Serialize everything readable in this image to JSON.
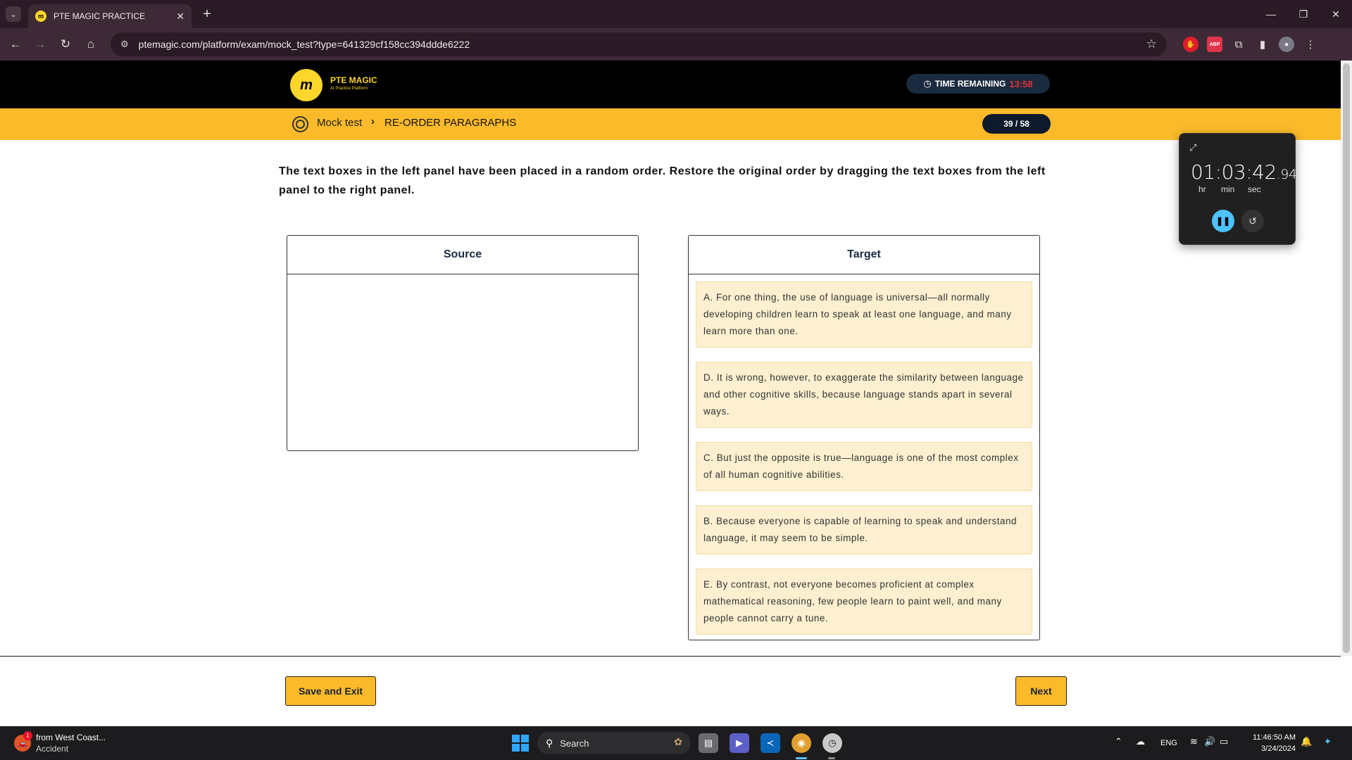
{
  "browser": {
    "tab_title": "PTE MAGIC PRACTICE",
    "url": "ptemagic.com/platform/exam/mock_test?type=641329cf158cc394ddde6222"
  },
  "header": {
    "logo_title": "PTE MAGIC",
    "logo_subtitle": "AI Practice Platform",
    "timer_label": "TIME REMAINING",
    "timer_value": "13:58"
  },
  "breadcrumb": {
    "parent": "Mock test",
    "current": "RE-ORDER PARAGRAPHS",
    "progress": "39 / 58"
  },
  "instructions": "The text boxes in the left panel have been placed in a random order. Restore the original order by dragging the text boxes from the left panel to the right panel.",
  "source": {
    "title": "Source",
    "items": []
  },
  "target": {
    "title": "Target",
    "items": [
      {
        "text": "A. For one thing, the use of language is universal—all normally developing children learn to speak at least one language, and many learn more than one."
      },
      {
        "text": "D. It is wrong, however, to exaggerate the similarity between language and other cognitive skills, because language stands apart in several ways."
      },
      {
        "text": "C. But just the opposite is true—language is one of the most complex of all human cognitive abilities."
      },
      {
        "text": "B. Because everyone is capable of learning to speak and understand language, it may seem to be simple."
      },
      {
        "text": "E. By contrast, not everyone becomes proficient at complex mathematical reasoning, few people learn to paint well, and many people cannot carry a tune."
      }
    ]
  },
  "footer": {
    "save_label": "Save and Exit",
    "next_label": "Next"
  },
  "stopwatch": {
    "time": "01:03:42",
    "fraction": ".94",
    "unit_hr": "hr",
    "unit_min": "min",
    "unit_sec": "sec"
  },
  "taskbar": {
    "notif_title": "from West Coast...",
    "notif_sub": "Accident",
    "notif_count": "1",
    "search_label": "Search",
    "lang": "ENG",
    "clock_time": "11:46:50 AM",
    "clock_date": "3/24/2024"
  },
  "colors": {
    "brand_yellow": "#fcd62a",
    "subheader_orange": "#fbba2a",
    "item_bg": "#fdf0d0",
    "timer_red": "#e3343a"
  }
}
